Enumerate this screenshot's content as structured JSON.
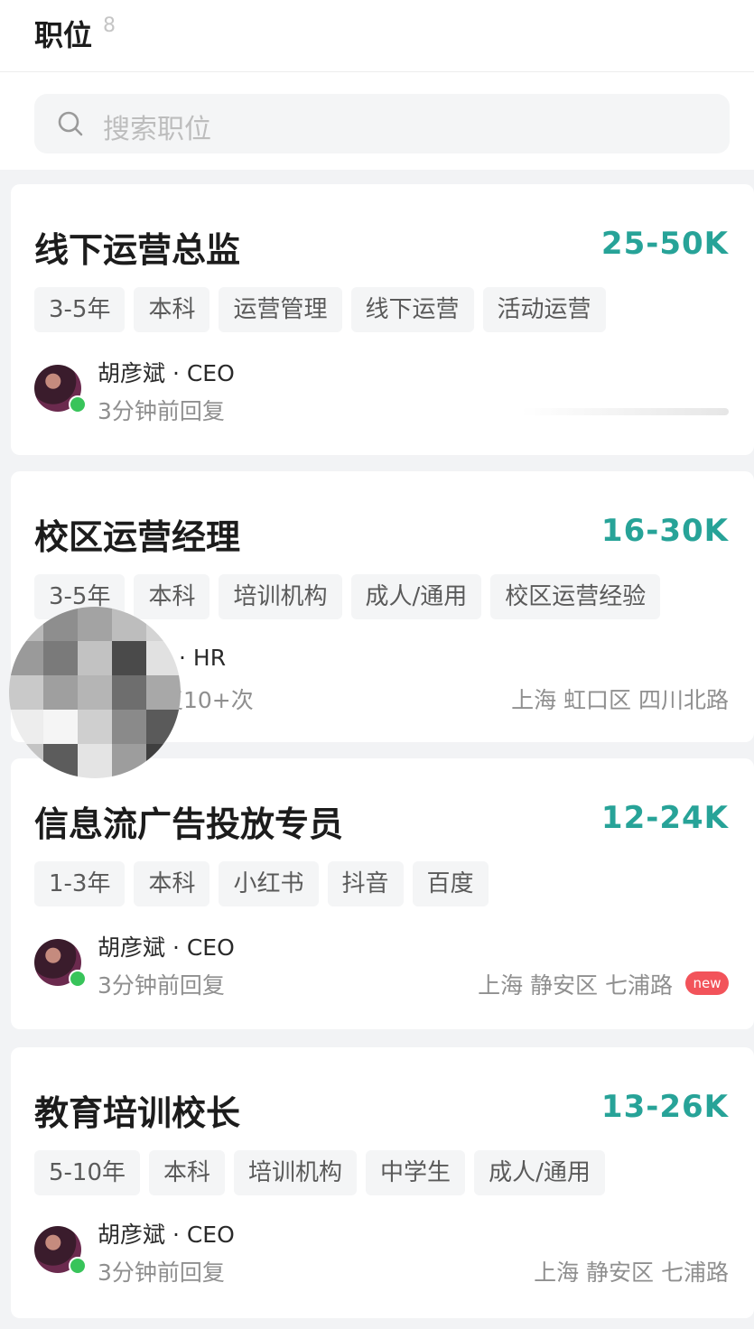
{
  "header": {
    "title": "职位",
    "count": "8"
  },
  "search": {
    "placeholder": "搜索职位",
    "icon": "search-icon"
  },
  "jobs": [
    {
      "title": "线下运营总监",
      "salary": "25-50K",
      "tags": [
        "3-5年",
        "本科",
        "运营管理",
        "线下运营",
        "活动运营"
      ],
      "recruiter": "胡彦斌 · CEO",
      "reply": "3分钟前回复",
      "location": ""
    },
    {
      "title": "校区运营经理",
      "salary": "16-30K",
      "tags": [
        "3-5年",
        "本科",
        "培训机构",
        "成人/通用",
        "校区运营经验"
      ],
      "recruiter": "· HR",
      "reply": "复10+次",
      "location": "上海 虹口区 四川北路"
    },
    {
      "title": "信息流广告投放专员",
      "salary": "12-24K",
      "tags": [
        "1-3年",
        "本科",
        "小红书",
        "抖音",
        "百度"
      ],
      "recruiter": "胡彦斌 · CEO",
      "reply": "3分钟前回复",
      "location": "上海 静安区 七浦路",
      "badge": "new"
    },
    {
      "title": "教育培训校长",
      "salary": "13-26K",
      "tags": [
        "5-10年",
        "本科",
        "培训机构",
        "中学生",
        "成人/通用"
      ],
      "recruiter": "胡彦斌 · CEO",
      "reply": "3分钟前回复",
      "location": "上海 静安区 七浦路"
    }
  ],
  "colors": {
    "salary": "#27a398",
    "online": "#38c45a",
    "badge": "#f2535a"
  }
}
